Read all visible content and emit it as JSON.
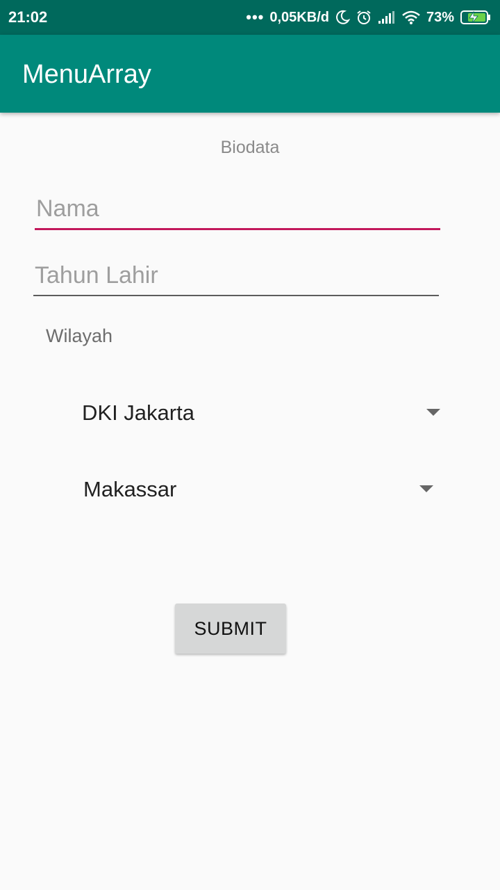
{
  "status_bar": {
    "time": "21:02",
    "dots": "•••",
    "network_speed": "0,05KB/d",
    "battery": "73%",
    "icons": [
      "moon-icon",
      "alarm-icon",
      "signal-icon",
      "wifi-icon",
      "battery-charging-icon"
    ]
  },
  "app_bar": {
    "title": "MenuArray"
  },
  "form": {
    "section_title": "Biodata",
    "nama_placeholder": "Nama",
    "tahun_placeholder": "Tahun Lahir",
    "wilayah_label": "Wilayah",
    "spinner1_value": "DKI Jakarta",
    "spinner2_value": "Makassar",
    "submit_label": "SUBMIT"
  },
  "colors": {
    "status_bar": "#00695c",
    "app_bar": "#00897b",
    "accent": "#c2185b",
    "background": "#fafafa",
    "button": "#d6d7d7"
  }
}
